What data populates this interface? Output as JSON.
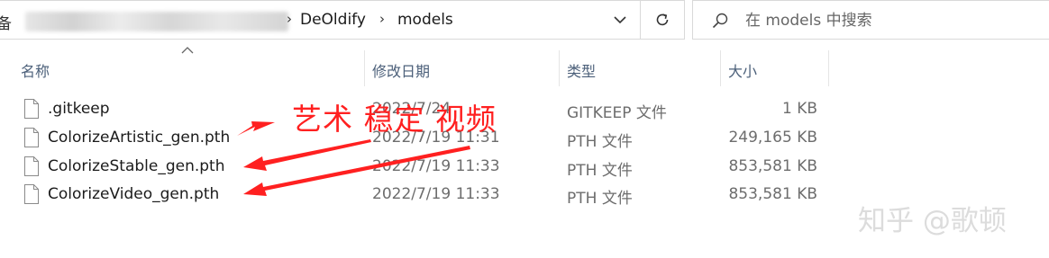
{
  "address_bar": {
    "partial_prefix": "备",
    "crumbs": [
      "DeOldify",
      "models"
    ]
  },
  "search": {
    "placeholder": "在 models 中搜索"
  },
  "columns": {
    "name": "名称",
    "date": "修改日期",
    "type": "类型",
    "size": "大小"
  },
  "files": [
    {
      "name": ".gitkeep",
      "date": "2022/7/24",
      "type": "GITKEEP 文件",
      "size": "1 KB"
    },
    {
      "name": "ColorizeArtistic_gen.pth",
      "date": "2022/7/19 11:31",
      "type": "PTH 文件",
      "size": "249,165 KB"
    },
    {
      "name": "ColorizeStable_gen.pth",
      "date": "2022/7/19 11:33",
      "type": "PTH 文件",
      "size": "853,581 KB"
    },
    {
      "name": "ColorizeVideo_gen.pth",
      "date": "2022/7/19 11:33",
      "type": "PTH 文件",
      "size": "853,581 KB"
    }
  ],
  "annotation": {
    "text": "艺术 稳定  视频",
    "color": "#ff2020"
  },
  "watermark": "知乎 @歌顿",
  "icons": {
    "dropdown": "chevron-down-icon",
    "refresh": "refresh-icon",
    "search": "search-icon",
    "sort": "sort-up-icon",
    "file": "file-icon"
  }
}
